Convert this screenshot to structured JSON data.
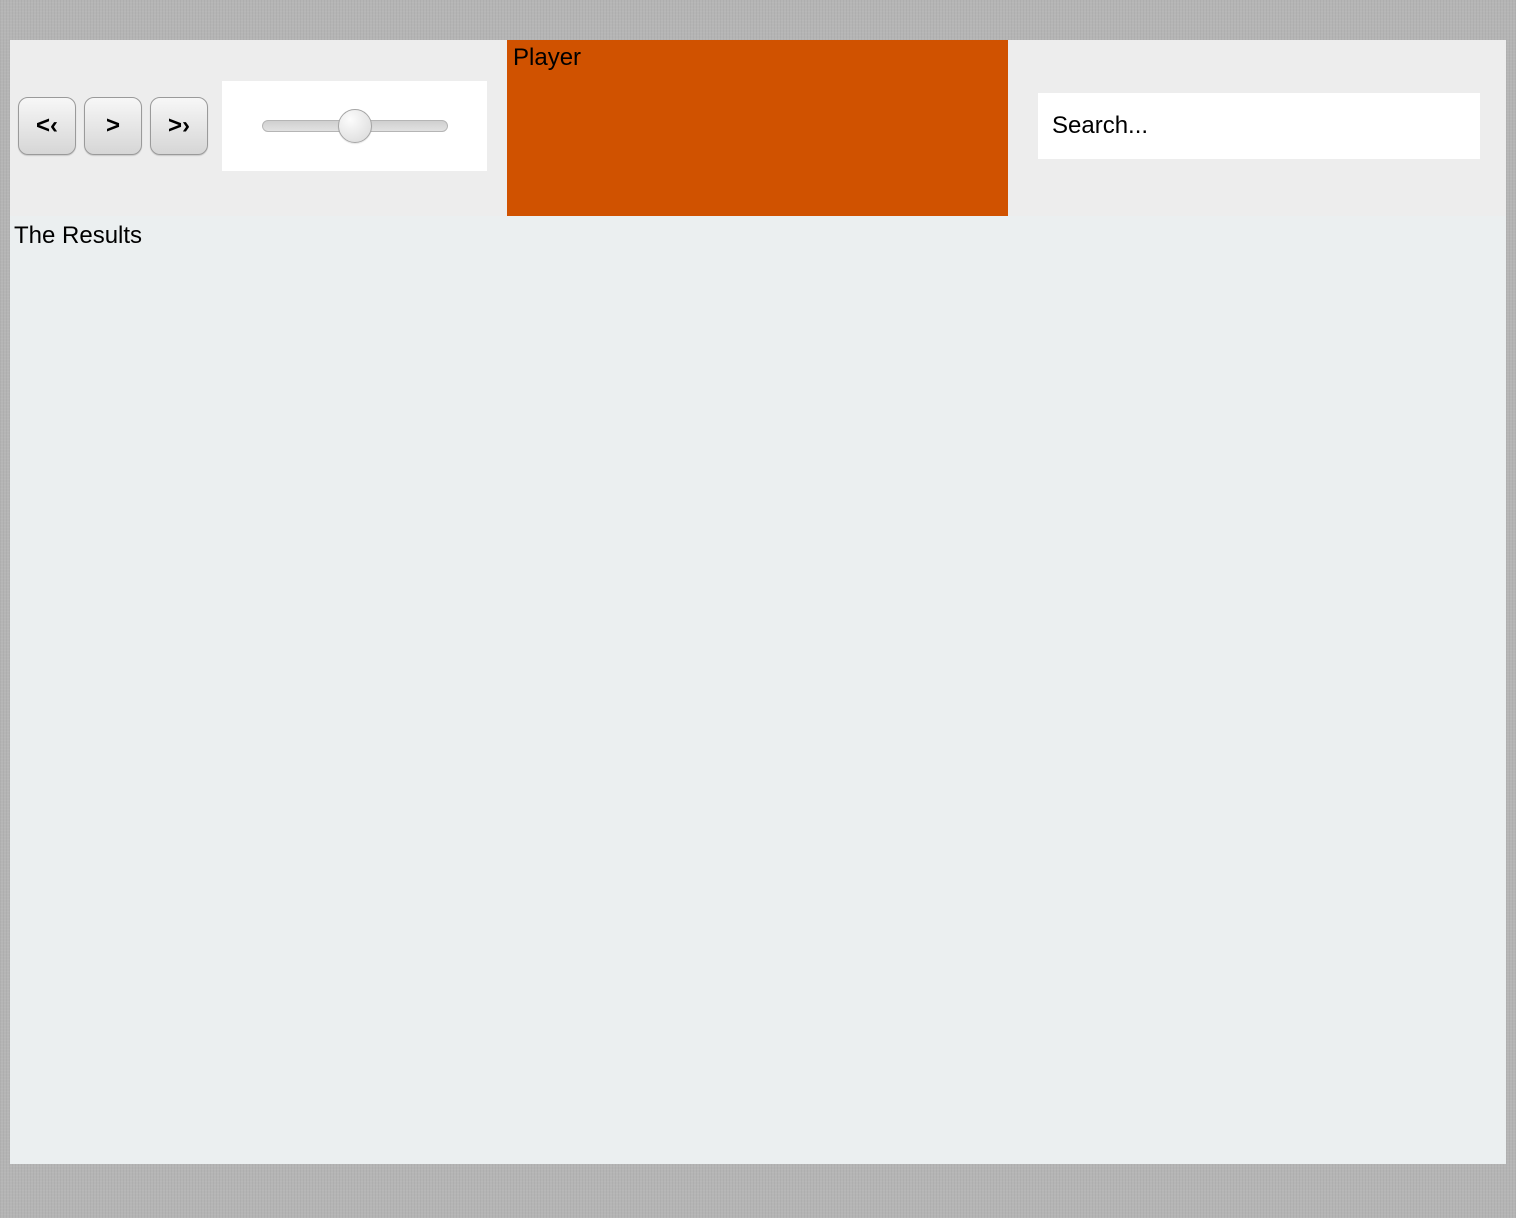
{
  "controls": {
    "prev_label": "<‹",
    "play_label": ">",
    "next_label": ">›"
  },
  "volume": {
    "percent": 50
  },
  "player": {
    "title": "Player"
  },
  "search": {
    "placeholder": "Search...",
    "value": ""
  },
  "results": {
    "heading": "The Results"
  },
  "colors": {
    "topbar_bg": "#ededed",
    "player_bg": "#d05200",
    "body_bg": "#b5b5b5",
    "results_bg": "#ebeff0"
  }
}
